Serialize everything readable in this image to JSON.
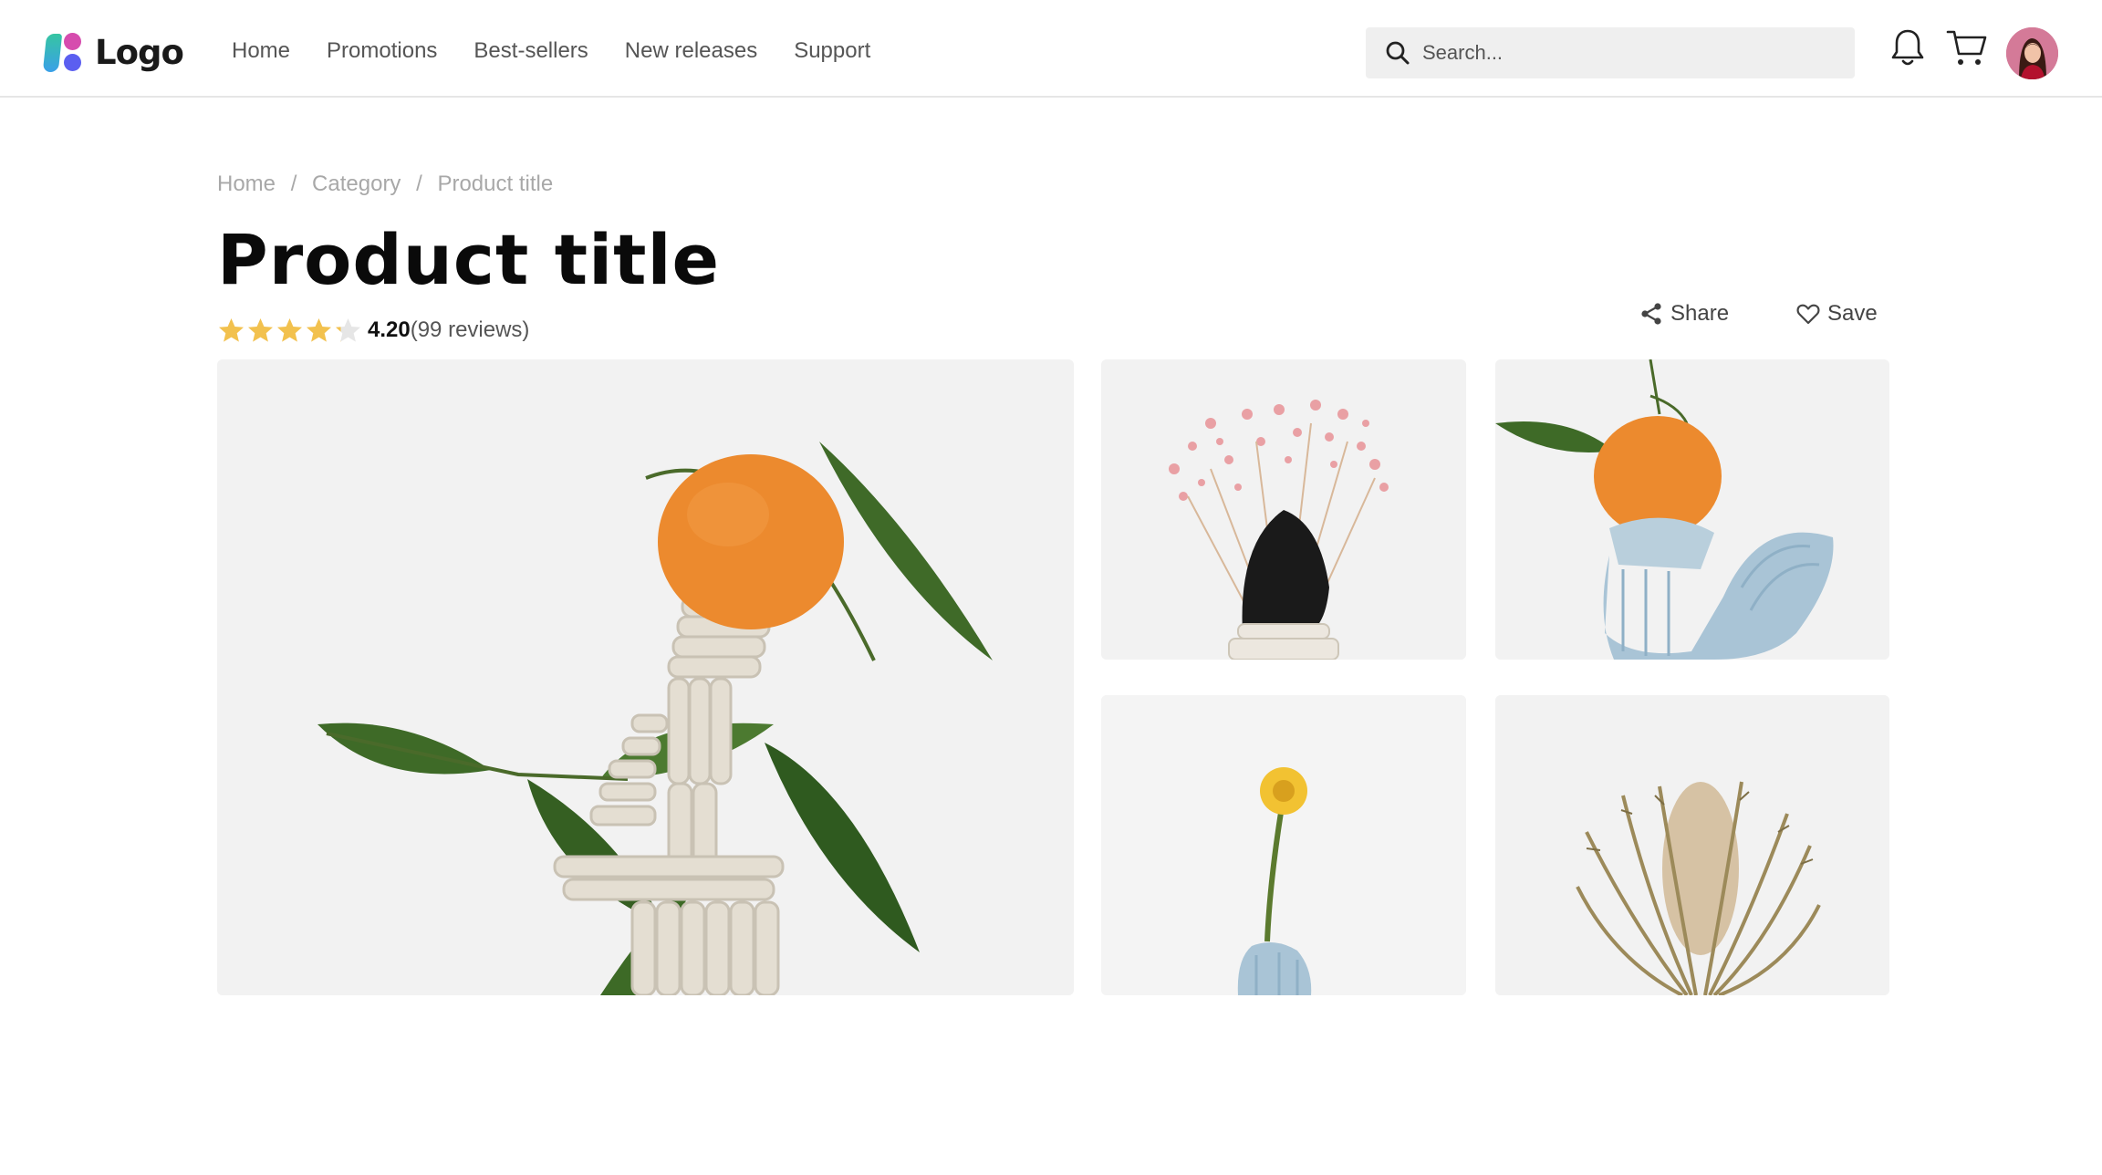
{
  "header": {
    "logo_text": "Logo",
    "nav": [
      "Home",
      "Promotions",
      "Best-sellers",
      "New releases",
      "Support"
    ],
    "search_placeholder": "Search...",
    "icons": [
      "search-icon",
      "bell-icon",
      "cart-icon",
      "avatar"
    ]
  },
  "breadcrumb": [
    "Home",
    "Category",
    "Product title"
  ],
  "product": {
    "title": "Product title",
    "rating_value": "4.20",
    "rating_stars": 4.2,
    "review_count": "(99 reviews)",
    "share_label": "Share",
    "save_label": "Save"
  },
  "gallery": {
    "images": [
      "orange-on-clay-stack",
      "pink-gypsophila-black-stone",
      "orange-on-blue-u-vase",
      "yellow-flower-blue-vase",
      "dried-banksia"
    ]
  },
  "colors": {
    "star": "#f2c14e",
    "search_bg": "#efefef",
    "logo_dot_pink": "#d64cae",
    "logo_dot_blue": "#5b5ff0"
  }
}
